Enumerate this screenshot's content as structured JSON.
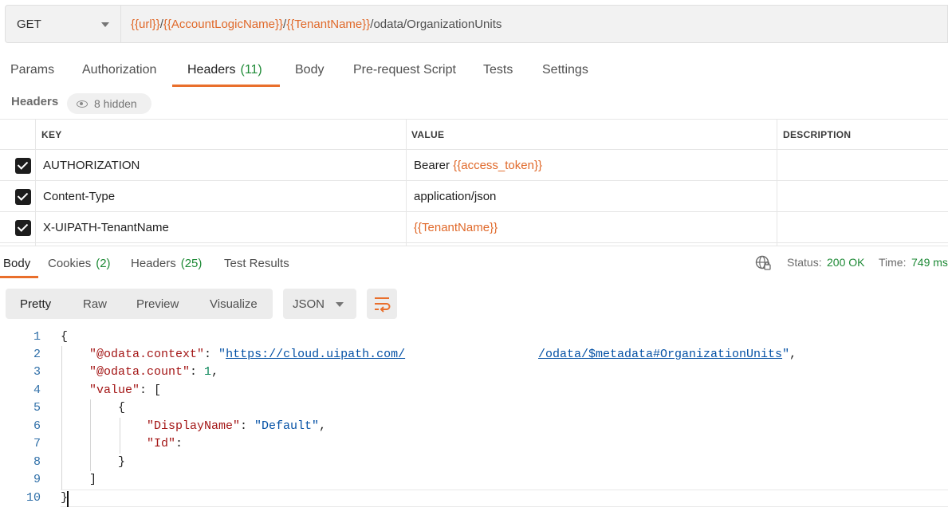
{
  "request": {
    "method": "GET",
    "url_parts": [
      {
        "text": "{{url}}",
        "var": true
      },
      {
        "text": "/",
        "var": false
      },
      {
        "text": "{{AccountLogicName}}",
        "var": true
      },
      {
        "text": "/",
        "var": false
      },
      {
        "text": "{{TenantName}}",
        "var": true
      },
      {
        "text": "/odata/OrganizationUnits",
        "var": false
      }
    ]
  },
  "tabs": {
    "params": "Params",
    "authorization": "Authorization",
    "headers": "Headers",
    "headers_count": "(11)",
    "body": "Body",
    "prerequest": "Pre-request Script",
    "tests": "Tests",
    "settings": "Settings"
  },
  "headers_section": {
    "label": "Headers",
    "hidden": "8 hidden",
    "columns": {
      "key": "KEY",
      "value": "VALUE",
      "description": "DESCRIPTION"
    },
    "rows": [
      {
        "key": "AUTHORIZATION",
        "value_plain": "Bearer ",
        "value_var": "{{access_token}}"
      },
      {
        "key": "Content-Type",
        "value_plain": "application/json",
        "value_var": ""
      },
      {
        "key": "X-UIPATH-TenantName",
        "value_plain": "",
        "value_var": "{{TenantName}}"
      }
    ]
  },
  "response": {
    "tabs": {
      "body": "Body",
      "cookies": "Cookies",
      "cookies_count": "(2)",
      "headers": "Headers",
      "headers_count": "(25)",
      "test_results": "Test Results"
    },
    "status_label": "Status:",
    "status_value": "200 OK",
    "time_label": "Time:",
    "time_value": "749 ms"
  },
  "viewer": {
    "pretty": "Pretty",
    "raw": "Raw",
    "preview": "Preview",
    "visualize": "Visualize",
    "format": "JSON"
  },
  "code": {
    "line_numbers": [
      "1",
      "2",
      "3",
      "4",
      "5",
      "6",
      "7",
      "8",
      "9",
      "10"
    ],
    "open_brace": "{",
    "context_key": "\"@odata.context\"",
    "context_url_a": "https://cloud.uipath.com/",
    "context_url_b": "/odata/$metadata#OrganizationUnits",
    "count_key": "\"@odata.count\"",
    "count_value": "1",
    "value_key": "\"value\"",
    "open_bracket": "[",
    "obj_open": "{",
    "displayname_key": "\"DisplayName\"",
    "displayname_value": "\"Default\"",
    "id_key": "\"Id\"",
    "obj_close": "}",
    "close_bracket": "]",
    "close_brace": "}"
  }
}
